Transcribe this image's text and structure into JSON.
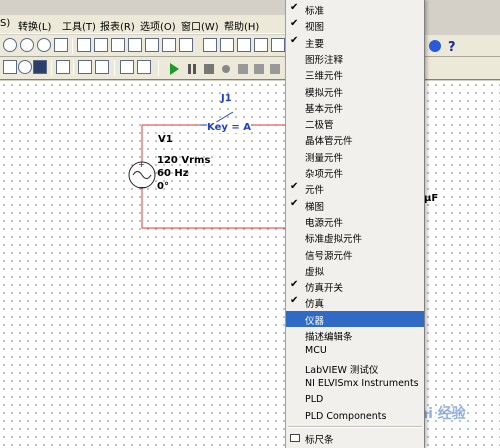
{
  "menubar": {
    "items": [
      "S)",
      "转换(L)",
      "工具(T)",
      "报表(R)",
      "选项(O)",
      "窗口(W)",
      "帮助(H)"
    ]
  },
  "schematic": {
    "switch_name": "J1",
    "switch_key": "Key = A",
    "source_name": "V1",
    "source_voltage": "120 Vrms",
    "source_freq": "60 Hz",
    "source_phase": "0°",
    "cap_partial": "μF"
  },
  "context_menu": {
    "items": [
      {
        "label": "标准",
        "checked": true
      },
      {
        "label": "视图",
        "checked": true
      },
      {
        "label": "主要",
        "checked": true
      },
      {
        "label": "图形注释",
        "checked": false
      },
      {
        "label": "三维元件",
        "checked": false
      },
      {
        "label": "模拟元件",
        "checked": false
      },
      {
        "label": "基本元件",
        "checked": false
      },
      {
        "label": "二极管",
        "checked": false
      },
      {
        "label": "晶体管元件",
        "checked": false
      },
      {
        "label": "测量元件",
        "checked": false
      },
      {
        "label": "杂项元件",
        "checked": false
      },
      {
        "label": "元件",
        "checked": true
      },
      {
        "label": "梯图",
        "checked": true
      },
      {
        "label": "电源元件",
        "checked": false
      },
      {
        "label": "标准虚拟元件",
        "checked": false
      },
      {
        "label": "信号源元件",
        "checked": false
      },
      {
        "label": "虚拟",
        "checked": false
      },
      {
        "label": "仿真开关",
        "checked": true
      },
      {
        "label": "仿真",
        "checked": true
      },
      {
        "label": "仪器",
        "checked": false,
        "selected": true
      },
      {
        "label": "描述编辑条",
        "checked": false
      },
      {
        "label": "MCU",
        "checked": false
      },
      {
        "label": "LabVIEW 测试仪",
        "checked": false
      },
      {
        "label": "NI ELVISmx Instruments",
        "checked": false
      },
      {
        "label": "PLD",
        "checked": false
      },
      {
        "label": "PLD Components",
        "checked": false
      },
      {
        "label": "标尺条",
        "checked": false,
        "cut_off": true
      }
    ]
  },
  "watermark": "Bai 经验",
  "colors": {
    "wire": "#e8363a",
    "label": "#1f3fd0",
    "selection": "#316ac5"
  }
}
